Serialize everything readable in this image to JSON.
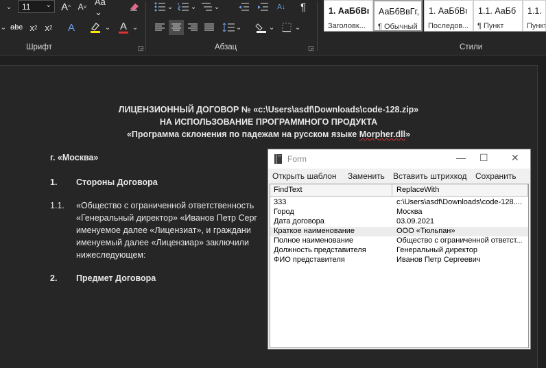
{
  "ribbon": {
    "font_size": "11",
    "groups": {
      "font": "Шрифт",
      "paragraph": "Абзац",
      "styles": "Стили"
    },
    "styles": [
      {
        "preview": "1. АаБбВı",
        "name": "Заголовк...",
        "bold": true
      },
      {
        "preview": "АаБбВвГг,",
        "name": "¶ Обычный",
        "bold": false,
        "selected": true
      },
      {
        "preview": "1. АаБбВı",
        "name": "Последов...",
        "bold": false
      },
      {
        "preview": "1.1. АаБб",
        "name": "¶ Пункт",
        "bold": false
      },
      {
        "preview": "1.1.",
        "name": "Пункт",
        "bold": false
      }
    ]
  },
  "document": {
    "title_line1": "ЛИЦЕНЗИОННЫЙ ДОГОВОР № «c:\\Users\\asdf\\Downloads\\code-128.zip»",
    "title_line2": "НА ИСПОЛЬЗОВАНИЕ ПРОГРАММНОГО ПРОДУКТА",
    "title_line3_pre": "«Программа склонения по падежам на русском языке ",
    "title_line3_word": "Morpher.dll",
    "title_line3_post": "»",
    "city": "г. «Москва»",
    "sec1_num": "1.",
    "sec1_title": "Стороны Договора",
    "p11_num": "1.1.",
    "p11_lines": [
      "«Общество с ограниченной ответственность",
      "«Генеральный директор» «Иванов Петр Серг",
      "именуемое далее «Лицензиат», и граждани",
      "именуемый далее «Лицензиар» заключили",
      "нижеследующем:"
    ],
    "sec2_num": "2.",
    "sec2_title": "Предмет Договора"
  },
  "form": {
    "title": "Form",
    "menu": [
      "Открыть шаблон",
      "Заменить",
      "Вставить штрихкод",
      "Сохранить"
    ],
    "columns": [
      "FindText",
      "ReplaceWith"
    ],
    "rows": [
      [
        "333",
        "c:\\Users\\asdf\\Downloads\\code-128...."
      ],
      [
        "Город",
        "Москва"
      ],
      [
        "Дата договора",
        "03.09.2021"
      ],
      [
        "Краткое наименование",
        "ООО «Тюльпан»"
      ],
      [
        "Полное наименование",
        "Общество с ограниченной ответст..."
      ],
      [
        "Должность представителя",
        "Генеральный директор"
      ],
      [
        "ФИО представителя",
        "Иванов Петр Сергеевич"
      ]
    ]
  }
}
